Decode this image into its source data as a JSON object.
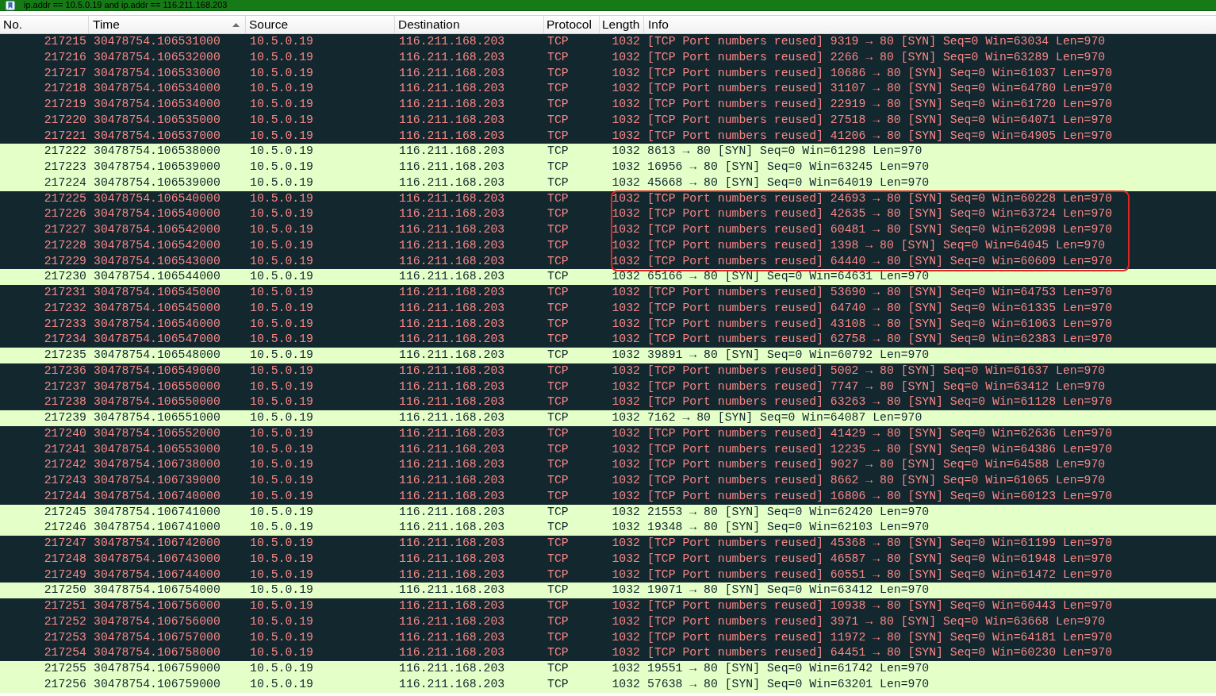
{
  "filter_bar": {
    "value": "ip.addr == 10.5.0.19 and ip.addr == 116.211.168.203"
  },
  "table": {
    "columns": [
      {
        "label": "No.",
        "sorted": false
      },
      {
        "label": "Time",
        "sorted": true
      },
      {
        "label": "Source",
        "sorted": false
      },
      {
        "label": "Destination",
        "sorted": false
      },
      {
        "label": "Protocol",
        "sorted": false
      },
      {
        "label": "Length",
        "sorted": false
      },
      {
        "label": "Info",
        "sorted": false
      }
    ],
    "rows": [
      {
        "no": "217215",
        "time": "30478754.106531000",
        "source": "10.5.0.19",
        "destination": "116.211.168.203",
        "protocol": "TCP",
        "length": "1032",
        "info": "[TCP Port numbers reused] 9319 → 80 [SYN] Seq=0 Win=63034 Len=970",
        "color": "#12272e",
        "outlined": false
      },
      {
        "no": "217216",
        "time": "30478754.106532000",
        "source": "10.5.0.19",
        "destination": "116.211.168.203",
        "protocol": "TCP",
        "length": "1032",
        "info": "[TCP Port numbers reused] 2266 → 80 [SYN] Seq=0 Win=63289 Len=970",
        "color": "#12272e",
        "outlined": false
      },
      {
        "no": "217217",
        "time": "30478754.106533000",
        "source": "10.5.0.19",
        "destination": "116.211.168.203",
        "protocol": "TCP",
        "length": "1032",
        "info": "[TCP Port numbers reused] 10686 → 80 [SYN] Seq=0 Win=61037 Len=970",
        "color": "#12272e",
        "outlined": false
      },
      {
        "no": "217218",
        "time": "30478754.106534000",
        "source": "10.5.0.19",
        "destination": "116.211.168.203",
        "protocol": "TCP",
        "length": "1032",
        "info": "[TCP Port numbers reused] 31107 → 80 [SYN] Seq=0 Win=64780 Len=970",
        "color": "#12272e",
        "outlined": false
      },
      {
        "no": "217219",
        "time": "30478754.106534000",
        "source": "10.5.0.19",
        "destination": "116.211.168.203",
        "protocol": "TCP",
        "length": "1032",
        "info": "[TCP Port numbers reused] 22919 → 80 [SYN] Seq=0 Win=61720 Len=970",
        "color": "#12272e",
        "outlined": false
      },
      {
        "no": "217220",
        "time": "30478754.106535000",
        "source": "10.5.0.19",
        "destination": "116.211.168.203",
        "protocol": "TCP",
        "length": "1032",
        "info": "[TCP Port numbers reused] 27518 → 80 [SYN] Seq=0 Win=64071 Len=970",
        "color": "#12272e",
        "outlined": false
      },
      {
        "no": "217221",
        "time": "30478754.106537000",
        "source": "10.5.0.19",
        "destination": "116.211.168.203",
        "protocol": "TCP",
        "length": "1032",
        "info": "[TCP Port numbers reused] 41206 → 80 [SYN] Seq=0 Win=64905 Len=970",
        "color": "#12272e",
        "outlined": false
      },
      {
        "no": "217222",
        "time": "30478754.106538000",
        "source": "10.5.0.19",
        "destination": "116.211.168.203",
        "protocol": "TCP",
        "length": "1032",
        "info": "8613 → 80 [SYN] Seq=0 Win=61298 Len=970",
        "color": "#e4ffc7",
        "outlined": false
      },
      {
        "no": "217223",
        "time": "30478754.106539000",
        "source": "10.5.0.19",
        "destination": "116.211.168.203",
        "protocol": "TCP",
        "length": "1032",
        "info": "16956 → 80 [SYN] Seq=0 Win=63245 Len=970",
        "color": "#e4ffc7",
        "outlined": false
      },
      {
        "no": "217224",
        "time": "30478754.106539000",
        "source": "10.5.0.19",
        "destination": "116.211.168.203",
        "protocol": "TCP",
        "length": "1032",
        "info": "45668 → 80 [SYN] Seq=0 Win=64019 Len=970",
        "color": "#e4ffc7",
        "outlined": false
      },
      {
        "no": "217225",
        "time": "30478754.106540000",
        "source": "10.5.0.19",
        "destination": "116.211.168.203",
        "protocol": "TCP",
        "length": "1032",
        "info": "[TCP Port numbers reused] 24693 → 80 [SYN] Seq=0 Win=60228 Len=970",
        "color": "#12272e",
        "outlined": true
      },
      {
        "no": "217226",
        "time": "30478754.106540000",
        "source": "10.5.0.19",
        "destination": "116.211.168.203",
        "protocol": "TCP",
        "length": "1032",
        "info": "[TCP Port numbers reused] 42635 → 80 [SYN] Seq=0 Win=63724 Len=970",
        "color": "#12272e",
        "outlined": true
      },
      {
        "no": "217227",
        "time": "30478754.106542000",
        "source": "10.5.0.19",
        "destination": "116.211.168.203",
        "protocol": "TCP",
        "length": "1032",
        "info": "[TCP Port numbers reused] 60481 → 80 [SYN] Seq=0 Win=62098 Len=970",
        "color": "#12272e",
        "outlined": true
      },
      {
        "no": "217228",
        "time": "30478754.106542000",
        "source": "10.5.0.19",
        "destination": "116.211.168.203",
        "protocol": "TCP",
        "length": "1032",
        "info": "[TCP Port numbers reused] 1398 → 80 [SYN] Seq=0 Win=64045 Len=970",
        "color": "#12272e",
        "outlined": true
      },
      {
        "no": "217229",
        "time": "30478754.106543000",
        "source": "10.5.0.19",
        "destination": "116.211.168.203",
        "protocol": "TCP",
        "length": "1032",
        "info": "[TCP Port numbers reused] 64440 → 80 [SYN] Seq=0 Win=60609 Len=970",
        "color": "#12272e",
        "outlined": true
      },
      {
        "no": "217230",
        "time": "30478754.106544000",
        "source": "10.5.0.19",
        "destination": "116.211.168.203",
        "protocol": "TCP",
        "length": "1032",
        "info": "65166 → 80 [SYN] Seq=0 Win=64631 Len=970",
        "color": "#e4ffc7",
        "outlined": false
      },
      {
        "no": "217231",
        "time": "30478754.106545000",
        "source": "10.5.0.19",
        "destination": "116.211.168.203",
        "protocol": "TCP",
        "length": "1032",
        "info": "[TCP Port numbers reused] 53690 → 80 [SYN] Seq=0 Win=64753 Len=970",
        "color": "#12272e",
        "outlined": false
      },
      {
        "no": "217232",
        "time": "30478754.106545000",
        "source": "10.5.0.19",
        "destination": "116.211.168.203",
        "protocol": "TCP",
        "length": "1032",
        "info": "[TCP Port numbers reused] 64740 → 80 [SYN] Seq=0 Win=61335 Len=970",
        "color": "#12272e",
        "outlined": false
      },
      {
        "no": "217233",
        "time": "30478754.106546000",
        "source": "10.5.0.19",
        "destination": "116.211.168.203",
        "protocol": "TCP",
        "length": "1032",
        "info": "[TCP Port numbers reused] 43108 → 80 [SYN] Seq=0 Win=61063 Len=970",
        "color": "#12272e",
        "outlined": false
      },
      {
        "no": "217234",
        "time": "30478754.106547000",
        "source": "10.5.0.19",
        "destination": "116.211.168.203",
        "protocol": "TCP",
        "length": "1032",
        "info": "[TCP Port numbers reused] 62758 → 80 [SYN] Seq=0 Win=62383 Len=970",
        "color": "#12272e",
        "outlined": false
      },
      {
        "no": "217235",
        "time": "30478754.106548000",
        "source": "10.5.0.19",
        "destination": "116.211.168.203",
        "protocol": "TCP",
        "length": "1032",
        "info": "39891 → 80 [SYN] Seq=0 Win=60792 Len=970",
        "color": "#e4ffc7",
        "outlined": false
      },
      {
        "no": "217236",
        "time": "30478754.106549000",
        "source": "10.5.0.19",
        "destination": "116.211.168.203",
        "protocol": "TCP",
        "length": "1032",
        "info": "[TCP Port numbers reused] 5002 → 80 [SYN] Seq=0 Win=61637 Len=970",
        "color": "#12272e",
        "outlined": false
      },
      {
        "no": "217237",
        "time": "30478754.106550000",
        "source": "10.5.0.19",
        "destination": "116.211.168.203",
        "protocol": "TCP",
        "length": "1032",
        "info": "[TCP Port numbers reused] 7747 → 80 [SYN] Seq=0 Win=63412 Len=970",
        "color": "#12272e",
        "outlined": false
      },
      {
        "no": "217238",
        "time": "30478754.106550000",
        "source": "10.5.0.19",
        "destination": "116.211.168.203",
        "protocol": "TCP",
        "length": "1032",
        "info": "[TCP Port numbers reused] 63263 → 80 [SYN] Seq=0 Win=61128 Len=970",
        "color": "#12272e",
        "outlined": false
      },
      {
        "no": "217239",
        "time": "30478754.106551000",
        "source": "10.5.0.19",
        "destination": "116.211.168.203",
        "protocol": "TCP",
        "length": "1032",
        "info": "7162 → 80 [SYN] Seq=0 Win=64087 Len=970",
        "color": "#e4ffc7",
        "outlined": false
      },
      {
        "no": "217240",
        "time": "30478754.106552000",
        "source": "10.5.0.19",
        "destination": "116.211.168.203",
        "protocol": "TCP",
        "length": "1032",
        "info": "[TCP Port numbers reused] 41429 → 80 [SYN] Seq=0 Win=62636 Len=970",
        "color": "#12272e",
        "outlined": false
      },
      {
        "no": "217241",
        "time": "30478754.106553000",
        "source": "10.5.0.19",
        "destination": "116.211.168.203",
        "protocol": "TCP",
        "length": "1032",
        "info": "[TCP Port numbers reused] 12235 → 80 [SYN] Seq=0 Win=64386 Len=970",
        "color": "#12272e",
        "outlined": false
      },
      {
        "no": "217242",
        "time": "30478754.106738000",
        "source": "10.5.0.19",
        "destination": "116.211.168.203",
        "protocol": "TCP",
        "length": "1032",
        "info": "[TCP Port numbers reused] 9027 → 80 [SYN] Seq=0 Win=64588 Len=970",
        "color": "#12272e",
        "outlined": false
      },
      {
        "no": "217243",
        "time": "30478754.106739000",
        "source": "10.5.0.19",
        "destination": "116.211.168.203",
        "protocol": "TCP",
        "length": "1032",
        "info": "[TCP Port numbers reused] 8662 → 80 [SYN] Seq=0 Win=61065 Len=970",
        "color": "#12272e",
        "outlined": false
      },
      {
        "no": "217244",
        "time": "30478754.106740000",
        "source": "10.5.0.19",
        "destination": "116.211.168.203",
        "protocol": "TCP",
        "length": "1032",
        "info": "[TCP Port numbers reused] 16806 → 80 [SYN] Seq=0 Win=60123 Len=970",
        "color": "#12272e",
        "outlined": false
      },
      {
        "no": "217245",
        "time": "30478754.106741000",
        "source": "10.5.0.19",
        "destination": "116.211.168.203",
        "protocol": "TCP",
        "length": "1032",
        "info": "21553 → 80 [SYN] Seq=0 Win=62420 Len=970",
        "color": "#e4ffc7",
        "outlined": false
      },
      {
        "no": "217246",
        "time": "30478754.106741000",
        "source": "10.5.0.19",
        "destination": "116.211.168.203",
        "protocol": "TCP",
        "length": "1032",
        "info": "19348 → 80 [SYN] Seq=0 Win=62103 Len=970",
        "color": "#e4ffc7",
        "outlined": false
      },
      {
        "no": "217247",
        "time": "30478754.106742000",
        "source": "10.5.0.19",
        "destination": "116.211.168.203",
        "protocol": "TCP",
        "length": "1032",
        "info": "[TCP Port numbers reused] 45368 → 80 [SYN] Seq=0 Win=61199 Len=970",
        "color": "#12272e",
        "outlined": false
      },
      {
        "no": "217248",
        "time": "30478754.106743000",
        "source": "10.5.0.19",
        "destination": "116.211.168.203",
        "protocol": "TCP",
        "length": "1032",
        "info": "[TCP Port numbers reused] 46587 → 80 [SYN] Seq=0 Win=61948 Len=970",
        "color": "#12272e",
        "outlined": false
      },
      {
        "no": "217249",
        "time": "30478754.106744000",
        "source": "10.5.0.19",
        "destination": "116.211.168.203",
        "protocol": "TCP",
        "length": "1032",
        "info": "[TCP Port numbers reused] 60551 → 80 [SYN] Seq=0 Win=61472 Len=970",
        "color": "#12272e",
        "outlined": false
      },
      {
        "no": "217250",
        "time": "30478754.106754000",
        "source": "10.5.0.19",
        "destination": "116.211.168.203",
        "protocol": "TCP",
        "length": "1032",
        "info": "19071 → 80 [SYN] Seq=0 Win=63412 Len=970",
        "color": "#e4ffc7",
        "outlined": false
      },
      {
        "no": "217251",
        "time": "30478754.106756000",
        "source": "10.5.0.19",
        "destination": "116.211.168.203",
        "protocol": "TCP",
        "length": "1032",
        "info": "[TCP Port numbers reused] 10938 → 80 [SYN] Seq=0 Win=60443 Len=970",
        "color": "#12272e",
        "outlined": false
      },
      {
        "no": "217252",
        "time": "30478754.106756000",
        "source": "10.5.0.19",
        "destination": "116.211.168.203",
        "protocol": "TCP",
        "length": "1032",
        "info": "[TCP Port numbers reused] 3971 → 80 [SYN] Seq=0 Win=63668 Len=970",
        "color": "#12272e",
        "outlined": false
      },
      {
        "no": "217253",
        "time": "30478754.106757000",
        "source": "10.5.0.19",
        "destination": "116.211.168.203",
        "protocol": "TCP",
        "length": "1032",
        "info": "[TCP Port numbers reused] 11972 → 80 [SYN] Seq=0 Win=64181 Len=970",
        "color": "#12272e",
        "outlined": false
      },
      {
        "no": "217254",
        "time": "30478754.106758000",
        "source": "10.5.0.19",
        "destination": "116.211.168.203",
        "protocol": "TCP",
        "length": "1032",
        "info": "[TCP Port numbers reused] 64451 → 80 [SYN] Seq=0 Win=60230 Len=970",
        "color": "#12272e",
        "outlined": false
      },
      {
        "no": "217255",
        "time": "30478754.106759000",
        "source": "10.5.0.19",
        "destination": "116.211.168.203",
        "protocol": "TCP",
        "length": "1032",
        "info": "19551 → 80 [SYN] Seq=0 Win=61742 Len=970",
        "color": "#e4ffc7",
        "outlined": false
      },
      {
        "no": "217256",
        "time": "30478754.106759000",
        "source": "10.5.0.19",
        "destination": "116.211.168.203",
        "protocol": "TCP",
        "length": "1032",
        "info": "57638 → 80 [SYN] Seq=0 Win=63201 Len=970",
        "color": "#e4ffc7",
        "outlined": false
      }
    ]
  }
}
